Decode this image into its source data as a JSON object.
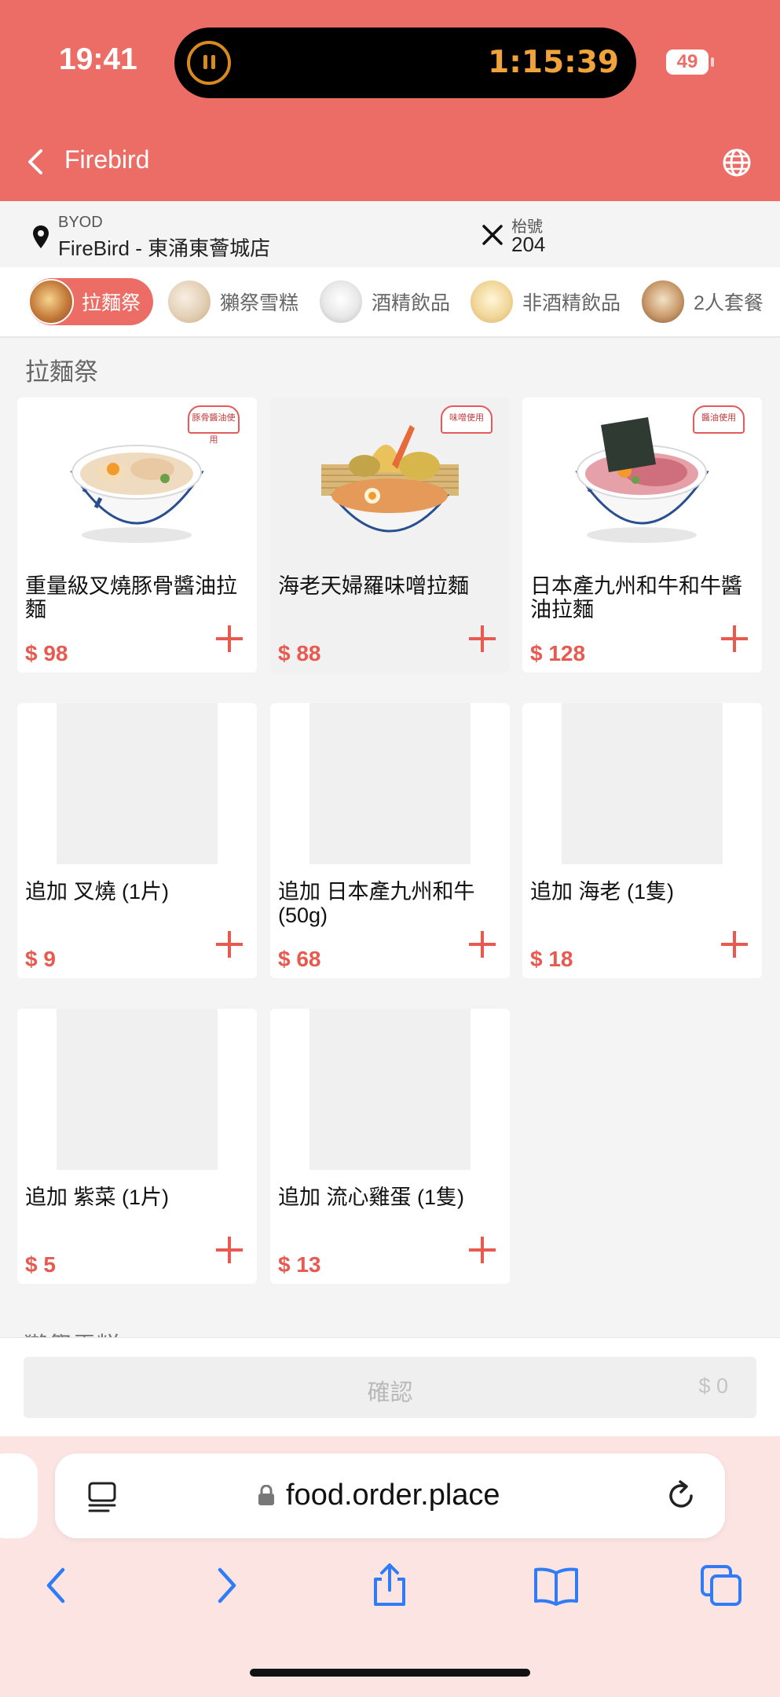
{
  "status_bar": {
    "time": "19:41",
    "timer": "1:15:39",
    "battery": "49"
  },
  "header": {
    "back_icon": "chevron-left-icon",
    "title": "Firebird",
    "language_icon": "globe-icon"
  },
  "store": {
    "label": "BYOD",
    "name": "FireBird - 東涌東薈城店",
    "table_label": "枱號",
    "table_number": "204"
  },
  "categories": [
    {
      "label": "拉麵祭",
      "active": true
    },
    {
      "label": "獺祭雪糕",
      "active": false
    },
    {
      "label": "酒精飲品",
      "active": false
    },
    {
      "label": "非酒精飲品",
      "active": false
    },
    {
      "label": "2人套餐",
      "active": false
    }
  ],
  "sections": [
    {
      "title": "拉麵祭",
      "items": [
        {
          "name": "重量級叉燒豚骨醬油拉麵",
          "price": "$ 98",
          "badge": "豚骨醬油使用"
        },
        {
          "name": "海老天婦羅味噌拉麵",
          "price": "$ 88",
          "badge": "味噌使用"
        },
        {
          "name": "日本產九州和牛和牛醬油拉麵",
          "price": "$ 128",
          "badge": "醬油使用"
        },
        {
          "name": "追加 叉燒 (1片)",
          "price": "$ 9"
        },
        {
          "name": "追加 日本產九州和牛 (50g)",
          "price": "$ 68"
        },
        {
          "name": "追加 海老 (1隻)",
          "price": "$ 18"
        },
        {
          "name": "追加 紫菜 (1片)",
          "price": "$ 5"
        },
        {
          "name": "追加 流心雞蛋 (1隻)",
          "price": "$ 13"
        }
      ]
    },
    {
      "title": "獺祭雪糕"
    }
  ],
  "footer": {
    "confirm_label": "確認",
    "total": "$ 0"
  },
  "browser": {
    "url": "food.order.place",
    "icons": [
      "reader-icon",
      "lock-icon",
      "reload-icon",
      "back-icon",
      "forward-icon",
      "share-icon",
      "bookmarks-icon",
      "tabs-icon"
    ]
  },
  "colors": {
    "brand": "#ec6d66",
    "price": "#e8594f"
  }
}
